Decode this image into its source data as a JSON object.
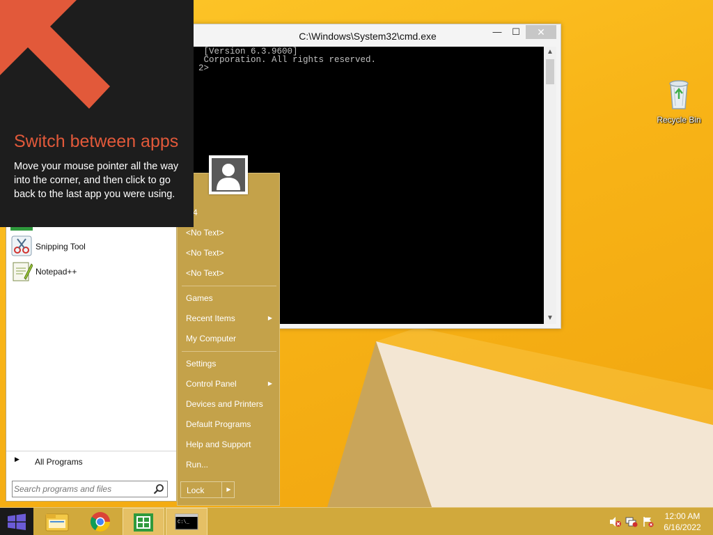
{
  "desktop": {
    "recycle_bin_label": "Recycle Bin"
  },
  "cmd_window": {
    "title": "C:\\Windows\\System32\\cmd.exe",
    "minimize_glyph": "—",
    "maximize_glyph": "☐",
    "close_glyph": "✕",
    "lines": [
      " [Version 6.3.9600]",
      " Corporation. All rights reserved.",
      "",
      "2>"
    ]
  },
  "hint": {
    "title": "Switch between apps",
    "body": "Move your mouse pointer all the way into the corner, and then click to go back to the last app you were using."
  },
  "start_menu": {
    "programs": [
      {
        "label": "Snipping Tool",
        "icon": "snipping-tool-icon"
      },
      {
        "label": "Notepad++",
        "icon": "notepad-plus-plus-icon"
      }
    ],
    "all_programs": "All Programs",
    "search_placeholder": "Search programs and files",
    "right_items": [
      {
        "label": "M4"
      },
      {
        "label": "<No Text>"
      },
      {
        "label": "<No Text>"
      },
      {
        "label": "<No Text>"
      },
      {
        "label": "Games"
      },
      {
        "label": "Recent Items",
        "submenu": true
      },
      {
        "label": "My Computer"
      },
      {
        "label": "Settings"
      },
      {
        "label": "Control Panel",
        "submenu": true
      },
      {
        "label": "Devices and Printers"
      },
      {
        "label": "Default Programs"
      },
      {
        "label": "Help and Support"
      },
      {
        "label": "Run..."
      }
    ],
    "lock_label": "Lock",
    "submenu_glyph": "▶"
  },
  "taskbar": {
    "items": [
      "windows-start-icon",
      "file-explorer-icon",
      "chrome-icon",
      "store-icon",
      "cmd-icon"
    ],
    "clock_time": "12:00 AM",
    "clock_date": "6/16/2022",
    "tray_icons": [
      "volume-muted-icon",
      "network-icon",
      "action-center-flag-icon"
    ]
  },
  "colors": {
    "hint_accent": "#e2593a",
    "start_right_bg": "#c4a24a",
    "taskbar_bg": "#d1a93c",
    "desktop_yellow": "#f8b417"
  }
}
